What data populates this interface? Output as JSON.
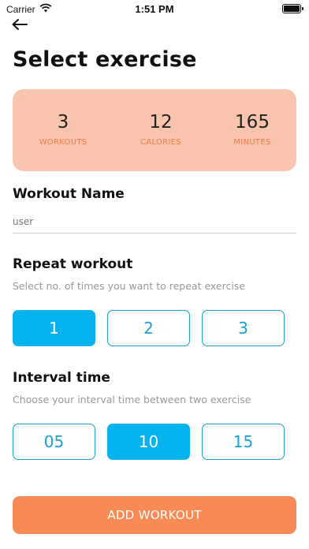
{
  "status_bar": {
    "carrier": "Carrier",
    "time": "1:51 PM"
  },
  "header": {
    "title": "Select exercise"
  },
  "stats": [
    {
      "value": "3",
      "label": "WORKOUTS"
    },
    {
      "value": "12",
      "label": "CALORIES"
    },
    {
      "value": "165",
      "label": "MINUTES"
    }
  ],
  "workout_name": {
    "title": "Workout Name",
    "value": "user"
  },
  "repeat": {
    "title": "Repeat workout",
    "subtitle": "Select no. of times you want to repeat exercise",
    "options": [
      "1",
      "2",
      "3"
    ],
    "selected": "1"
  },
  "interval": {
    "title": "Interval time",
    "subtitle": "Choose your interval time between two exercise",
    "options": [
      "05",
      "10",
      "15"
    ],
    "selected": "10"
  },
  "actions": {
    "add_label": "ADD WORKOUT"
  },
  "colors": {
    "accent_orange": "#f78a55",
    "card_bg": "#f9c4ad",
    "accent_blue": "#03b2ee"
  }
}
